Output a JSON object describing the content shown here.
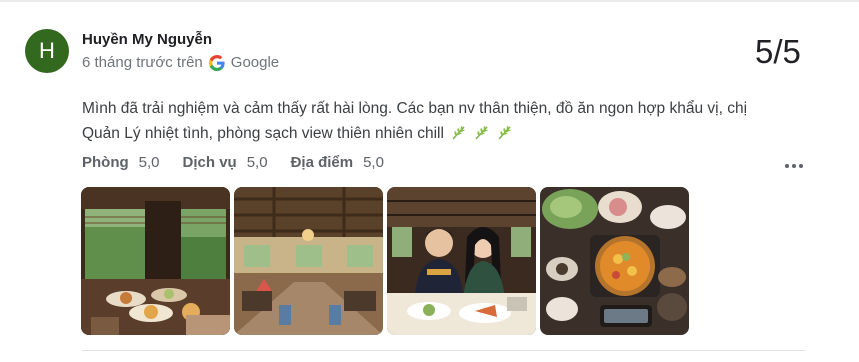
{
  "review": {
    "avatar_letter": "H",
    "reviewer_name": "Huyền My Nguyễn",
    "time_ago": "6 tháng trước trên",
    "source_name": "Google",
    "score": "5/5",
    "text": "Mình đã trải nghiệm và cảm thấy rất hài lòng. Các bạn nv thân thiện, đồ ăn ngon hợp khẩu vị, chị Quản Lý nhiệt tình, phòng sạch view thiên nhiên chill",
    "ratings": [
      {
        "label": "Phòng",
        "value": "5,0"
      },
      {
        "label": "Dịch vụ",
        "value": "5,0"
      },
      {
        "label": "Địa điểm",
        "value": "5,0"
      }
    ],
    "emoji_icons": [
      "herb-icon",
      "herb-icon",
      "herb-icon"
    ],
    "photos": [
      {
        "icon": "photo-food-table-view"
      },
      {
        "icon": "photo-restaurant-interior"
      },
      {
        "icon": "photo-couple-dining"
      },
      {
        "icon": "photo-hotpot"
      }
    ],
    "colors": {
      "avatar_bg": "#33691e",
      "meta_text": "#70757a"
    }
  }
}
